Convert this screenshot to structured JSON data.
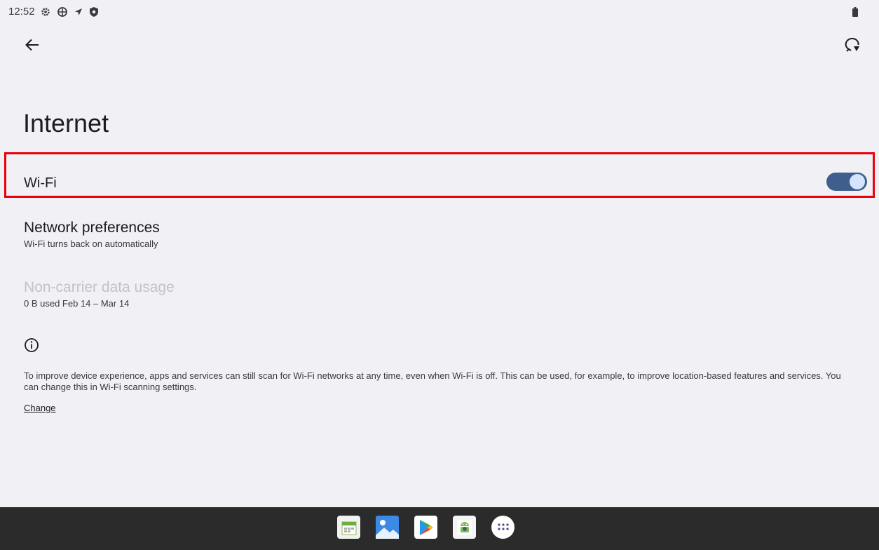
{
  "status_bar": {
    "time": "12:52",
    "icons": [
      "settings-icon",
      "gear-badge-icon",
      "location-arrow-icon",
      "shield-icon",
      "battery-icon"
    ]
  },
  "toolbar": {
    "back_icon": "arrow-left-icon",
    "help_icon": "help-feedback-icon"
  },
  "page": {
    "title": "Internet"
  },
  "wifi": {
    "label": "Wi-Fi",
    "enabled": true,
    "highlight_color": "#e8000b"
  },
  "network_preferences": {
    "title": "Network preferences",
    "subtitle": "Wi-Fi turns back on automatically"
  },
  "data_usage": {
    "title": "Non-carrier data usage",
    "subtitle": "0 B used Feb 14 – Mar 14"
  },
  "info": {
    "icon": "info-icon",
    "text": "To improve device experience, apps and services can still scan for Wi-Fi networks at any time, even when Wi-Fi is off. This can be used, for example, to improve location-based features and services. You can change this in Wi-Fi scanning settings.",
    "link": "Change"
  },
  "taskbar": {
    "apps": [
      "calendar-app-icon",
      "photos-app-icon",
      "play-store-icon",
      "android-app-icon",
      "all-apps-icon"
    ]
  },
  "colors": {
    "background": "#f1f0f5",
    "toggle_track": "#3e5f8e",
    "toggle_knob": "#d6e3ff",
    "taskbar": "#2b2b2b"
  }
}
